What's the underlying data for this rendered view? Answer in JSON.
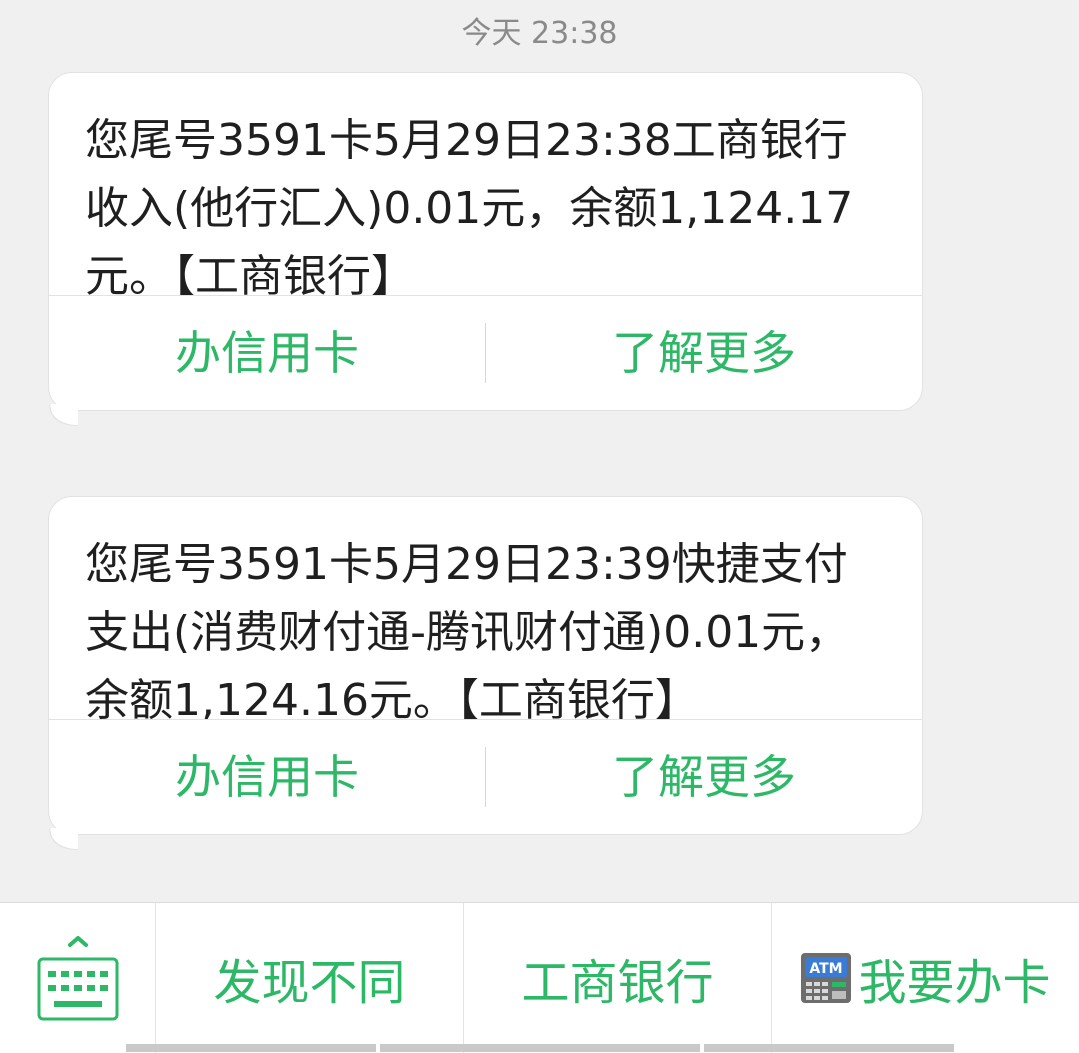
{
  "timestamp": "今天 23:38",
  "messages": [
    {
      "text": "您尾号3591卡5月29日23:38工商银行收入(他行汇入)0.01元，余额1,124.17元。【工商银行】",
      "actions": [
        "办信用卡",
        "了解更多"
      ]
    },
    {
      "text": "您尾号3591卡5月29日23:39快捷支付支出(消费财付通-腾讯财付通)0.01元，余额1,124.16元。【工商银行】",
      "actions": [
        "办信用卡",
        "了解更多"
      ]
    }
  ],
  "bottom_menu": {
    "keyboard_icon": "keyboard-icon",
    "items": [
      {
        "label": "发现不同"
      },
      {
        "label": "工商银行"
      },
      {
        "label": "我要办卡",
        "icon": "atm-icon"
      }
    ]
  },
  "colors": {
    "accent": "#2cb866",
    "background": "#f0f0f0",
    "bubble": "#ffffff",
    "text": "#1f1f1f",
    "timestamp": "#8a8a8a"
  }
}
